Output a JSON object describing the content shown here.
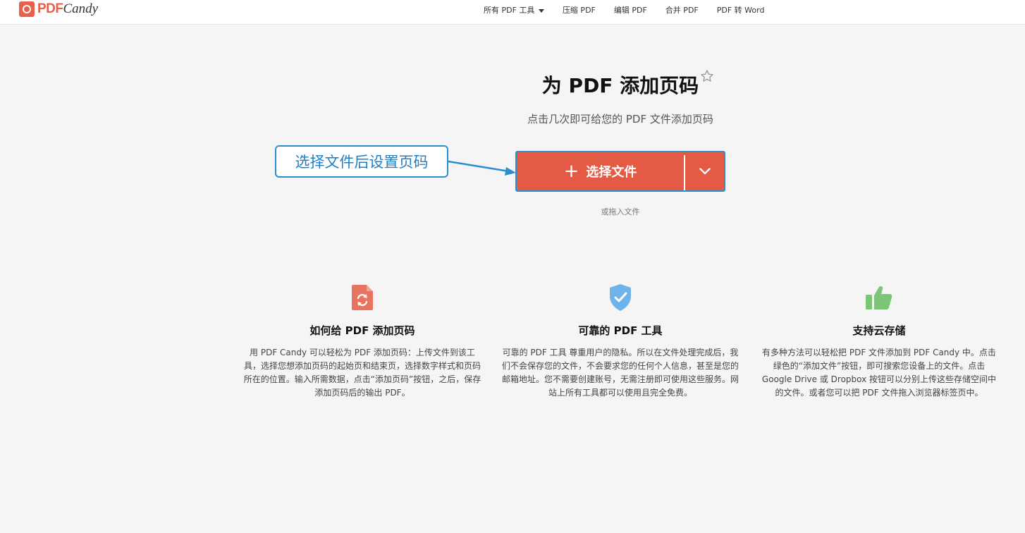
{
  "header": {
    "logo_pdf": "PDF",
    "logo_candy": "Candy",
    "nav": [
      {
        "label": "所有 PDF 工具"
      },
      {
        "label": "压缩 PDF"
      },
      {
        "label": "编辑 PDF"
      },
      {
        "label": "合并 PDF"
      },
      {
        "label": "PDF 转 Word"
      }
    ]
  },
  "main": {
    "title": "为 PDF 添加页码",
    "subtitle": "点击几次即可给您的 PDF 文件添加页码",
    "upload_label": "选择文件",
    "drop_hint": "或拖入文件"
  },
  "annotation": {
    "callout_text": "选择文件后设置页码",
    "color": "#2a8fd0"
  },
  "features": [
    {
      "icon": "document-refresh-icon",
      "title": "如何给 PDF 添加页码",
      "text": "用 PDF Candy 可以轻松为 PDF 添加页码：上传文件到该工具，选择您想添加页码的起始页和结束页，选择数字样式和页码所在的位置。输入所需数据，点击“添加页码”按钮，之后，保存添加页码后的输出 PDF。"
    },
    {
      "icon": "shield-check-icon",
      "title": "可靠的 PDF 工具",
      "text": "可靠的 PDF 工具 尊重用户的隐私。所以在文件处理完成后，我们不会保存您的文件，不会要求您的任何个人信息，甚至是您的邮箱地址。您不需要创建账号，无需注册即可使用这些服务。网站上所有工具都可以使用且完全免费。"
    },
    {
      "icon": "thumbs-up-icon",
      "title": "支持云存储",
      "text": "有多种方法可以轻松把 PDF 文件添加到 PDF Candy 中。点击绿色的“添加文件”按钮，即可搜索您设备上的文件。点击 Google Drive 或 Dropbox 按钮可以分别上传这些存储空间中的文件。或者您可以把 PDF 文件拖入浏览器标签页中。"
    }
  ],
  "colors": {
    "brand": "#e8604a",
    "upload_button": "#e45a44",
    "highlight_border": "#2592d1",
    "shield": "#6eb4ea",
    "thumb": "#7cc576"
  }
}
